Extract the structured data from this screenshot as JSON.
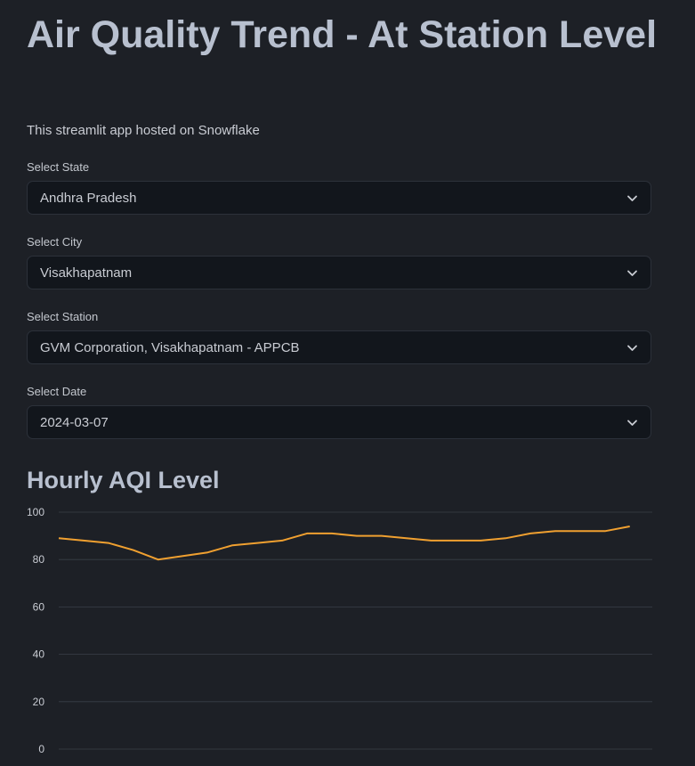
{
  "header": {
    "title": "Air Quality Trend - At Station Level",
    "subtitle": "This streamlit app hosted on Snowflake"
  },
  "filters": {
    "state": {
      "label": "Select State",
      "value": "Andhra Pradesh",
      "icon": "chevron-down-icon"
    },
    "city": {
      "label": "Select City",
      "value": "Visakhapatnam",
      "icon": "chevron-down-icon"
    },
    "station": {
      "label": "Select Station",
      "value": "GVM Corporation, Visakhapatnam - APPCB",
      "icon": "chevron-down-icon"
    },
    "date": {
      "label": "Select Date",
      "value": "2024-03-07",
      "icon": "chevron-down-icon"
    }
  },
  "chart_section": {
    "title": "Hourly AQI Level"
  },
  "chart_data": {
    "type": "line",
    "title": "Hourly AQI Level",
    "xlabel": "",
    "ylabel": "",
    "x": [
      0,
      1,
      2,
      3,
      4,
      5,
      6,
      7,
      8,
      9,
      10,
      11,
      12,
      13,
      14,
      15,
      16,
      17,
      18,
      19,
      20,
      21,
      22,
      23,
      24
    ],
    "series": [
      {
        "values": [
          89,
          88,
          87,
          84,
          80,
          81.5,
          83,
          86,
          87,
          88,
          91,
          91,
          90,
          90,
          89,
          88,
          88,
          88,
          89,
          91,
          92,
          92,
          92,
          94
        ],
        "color": "#f0a030"
      }
    ],
    "ylim": [
      0,
      100
    ],
    "yticks": [
      0,
      20,
      40,
      60,
      80,
      100
    ],
    "grid": true,
    "colors": {
      "background": "#1d2026",
      "grid": "#3a3f48",
      "tick_text": "#c9ccd3",
      "line": "#f0a030"
    }
  }
}
